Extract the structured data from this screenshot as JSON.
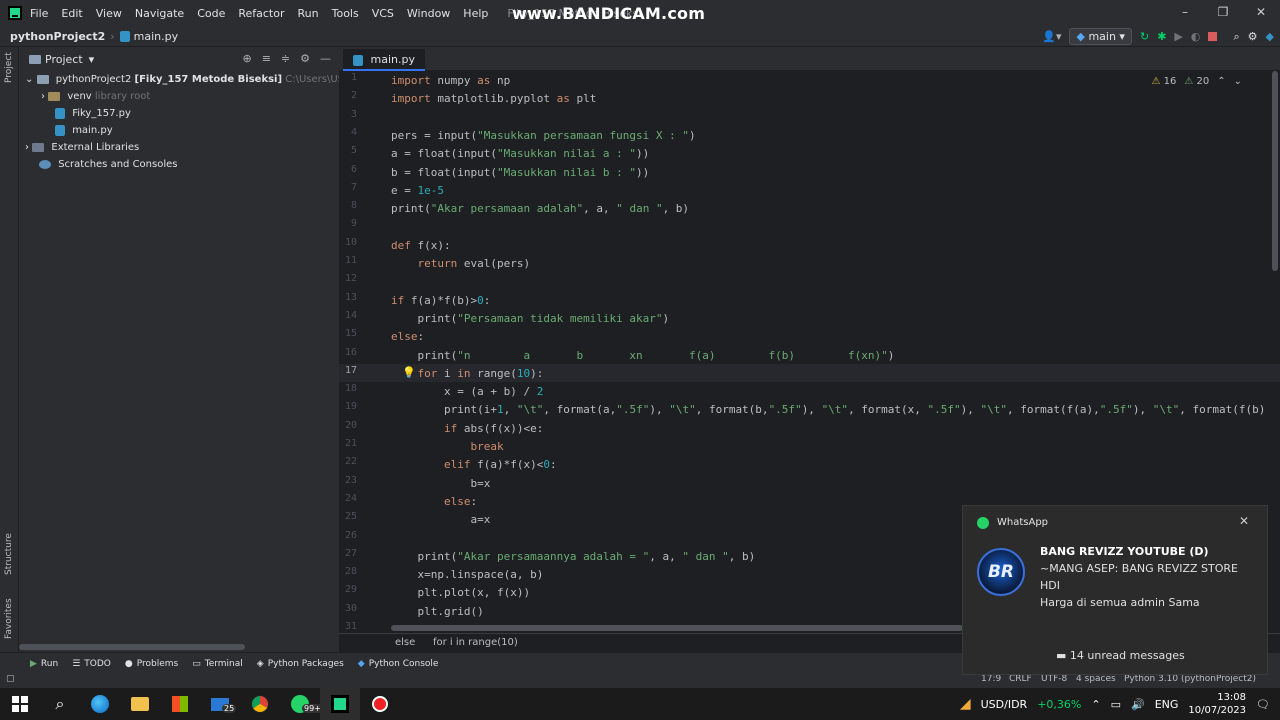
{
  "menu": {
    "items": [
      "File",
      "Edit",
      "View",
      "Navigate",
      "Code",
      "Refactor",
      "Run",
      "Tools",
      "VCS",
      "Window",
      "Help"
    ],
    "window_title": "Fiky_157 Metode Biseksi"
  },
  "watermark": "www.BANDICAM.com",
  "window_controls": [
    "–",
    "❐",
    "✕"
  ],
  "nav": {
    "project": "pythonProject2",
    "file": "main.py",
    "run_config": "main"
  },
  "left_strip": {
    "project": "Project",
    "structure": "Structure",
    "favorites": "Favorites"
  },
  "project_panel": {
    "title": "Project",
    "root": {
      "name": "pythonProject2",
      "module": "[Fiky_157 Metode Biseksi]",
      "path": "C:\\Users\\USER\\Pych"
    },
    "venv": {
      "name": "venv",
      "hint": "library root"
    },
    "files": [
      "Fiky_157.py",
      "main.py"
    ],
    "external": "External Libraries",
    "scratches": "Scratches and Consoles"
  },
  "editor": {
    "tab": "main.py",
    "warnings": "16",
    "weak_warnings": "20",
    "current_line": 17,
    "line_numbers": [
      "1",
      "2",
      "3",
      "4",
      "5",
      "6",
      "7",
      "8",
      "9",
      "10",
      "11",
      "12",
      "13",
      "14",
      "15",
      "16",
      "17",
      "18",
      "19",
      "20",
      "21",
      "22",
      "23",
      "24",
      "25",
      "26",
      "27",
      "28",
      "29",
      "30",
      "31"
    ],
    "lines": [
      "import numpy as np",
      "import matplotlib.pyplot as plt",
      "",
      "pers = input(\"Masukkan persamaan fungsi X : \")",
      "a = float(input(\"Masukkan nilai a : \"))",
      "b = float(input(\"Masukkan nilai b : \"))",
      "e = 1e-5",
      "print(\"Akar persamaan adalah\", a, \" dan \", b)",
      "",
      "def f(x):",
      "    return eval(pers)",
      "",
      "if f(a)*f(b)>0:",
      "    print(\"Persamaan tidak memiliki akar\")",
      "else:",
      "    print(\"n        a       b       xn       f(a)        f(b)        f(xn)\")",
      "    for i in range(10):",
      "        x = (a + b) / 2",
      "        print(i+1, \"\\t\", format(a,\".5f\"), \"\\t\", format(b,\".5f\"), \"\\t\", format(x, \".5f\"), \"\\t\", format(f(a),\".5f\"), \"\\t\", format(f(b)",
      "        if abs(f(x))<e:",
      "            break",
      "        elif f(a)*f(x)<0:",
      "            b=x",
      "        else:",
      "            a=x",
      "",
      "    print(\"Akar persamaannya adalah = \", a, \" dan \", b)",
      "    x=np.linspace(a, b)",
      "    plt.plot(x, f(x))",
      "    plt.grid()",
      ""
    ]
  },
  "breadcrumb": [
    "else",
    "for i in range(10)"
  ],
  "bottom_tools": [
    "Run",
    "TODO",
    "Problems",
    "Terminal",
    "Python Packages",
    "Python Console"
  ],
  "status": {
    "position": "17:9",
    "line_sep": "CRLF",
    "encoding": "UTF-8",
    "indent": "4 spaces",
    "interpreter": "Python 3.10 (pythonProject2)"
  },
  "notification": {
    "app": "WhatsApp",
    "title": "BANG REVIZZ YOUTUBE (D)",
    "line1": "~MANG ASEP: BANG REVIZZ STORE",
    "line2": "HDI",
    "line3": "Harga di semua admin Sama",
    "footer": "14 unread messages",
    "avatar_text": "BR"
  },
  "taskbar": {
    "mail_badge": "25",
    "whatsapp_badge": "99+",
    "currency": "USD/IDR",
    "currency_change": "+0,36%",
    "lang": "ENG",
    "time": "13:08",
    "date": "10/07/2023"
  },
  "colors": {
    "accent": "#3574f0",
    "keyword": "#cf8e6d",
    "string": "#6aab73",
    "positive": "#00d26a"
  }
}
